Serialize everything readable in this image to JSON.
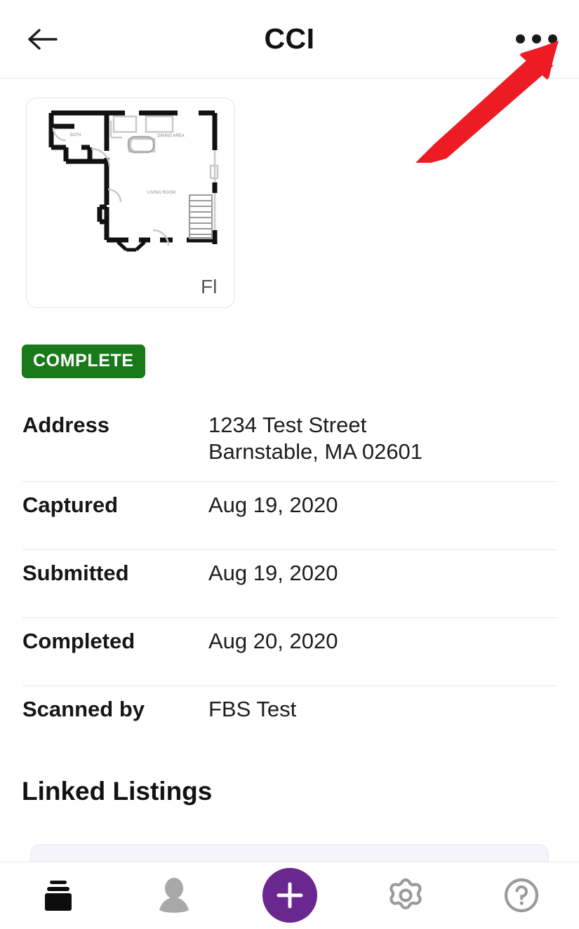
{
  "header": {
    "title": "CCI",
    "back_icon": "back-arrow-icon",
    "more_icon": "more-options-icon"
  },
  "annotation": {
    "type": "arrow",
    "color": "#ed1c24",
    "points_to": "more-options-button"
  },
  "thumbnail": {
    "icon": "floorplan-thumbnail",
    "clipped_label": "Fl",
    "room_labels": [
      "BATH",
      "DINING AREA",
      "LIVING ROOM"
    ]
  },
  "status": {
    "badge_label": "COMPLETE",
    "badge_color": "#1a7a1a",
    "badge_text_color": "#ffffff"
  },
  "details": [
    {
      "label": "Address",
      "value": "1234 Test Street",
      "value2": "Barnstable, MA 02601"
    },
    {
      "label": "Captured",
      "value": "Aug 19, 2020"
    },
    {
      "label": "Submitted",
      "value": "Aug 19, 2020"
    },
    {
      "label": "Completed",
      "value": "Aug 20, 2020"
    },
    {
      "label": "Scanned by",
      "value": "FBS Test"
    }
  ],
  "linked_listings": {
    "title": "Linked Listings"
  },
  "bottom_nav": {
    "accent_color": "#69278f",
    "items": [
      {
        "name": "jobs",
        "icon": "stacked-box-icon",
        "active": true
      },
      {
        "name": "profile",
        "icon": "person-icon",
        "active": false
      },
      {
        "name": "add",
        "icon": "plus-icon",
        "active": false
      },
      {
        "name": "settings",
        "icon": "gear-icon",
        "active": false
      },
      {
        "name": "help",
        "icon": "question-mark-circle-icon",
        "active": false
      }
    ]
  }
}
